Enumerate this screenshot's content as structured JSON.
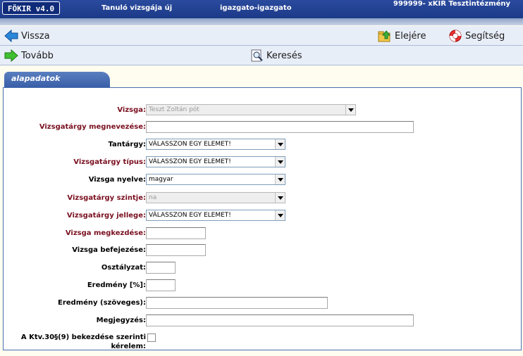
{
  "topbar": {
    "logo": "FÖKIR v4.0",
    "page": "Tanuló vizsgája új",
    "user": "igazgato-igazgato",
    "institution": "999999- xKIR Tesztintézmény"
  },
  "toolbar1": {
    "back": "Vissza",
    "top": "Elejére",
    "help": "Segítség"
  },
  "toolbar2": {
    "next": "Tovább",
    "search": "Keresés"
  },
  "tab": {
    "label": "alapadatok"
  },
  "form": {
    "vizsga": {
      "label": "Vizsga:",
      "value": "Teszt Zoltán pót"
    },
    "megnevezes": {
      "label": "Vizsgatárgy megnevezése:",
      "value": ""
    },
    "tantargy": {
      "label": "Tantárgy:",
      "value": "VÁLASSZON EGY ELEMET!"
    },
    "tipus": {
      "label": "Vizsgatárgy típus:",
      "value": "VÁLASSZON EGY ELEMET!"
    },
    "nyelv": {
      "label": "Vizsga nyelve:",
      "value": "magyar"
    },
    "szint": {
      "label": "Vizsgatárgy szintje:",
      "value": "na"
    },
    "jelleg": {
      "label": "Vizsgatárgy jellege:",
      "value": "VÁLASSZON EGY ELEMET!"
    },
    "kezdes": {
      "label": "Vizsga megkezdése:",
      "value": ""
    },
    "befejezes": {
      "label": "Vizsga befejezése:",
      "value": ""
    },
    "osztalyzat": {
      "label": "Osztályzat:",
      "value": ""
    },
    "eredmeny_szazalek": {
      "label": "Eredmény [%]:",
      "value": ""
    },
    "eredmeny_szoveges": {
      "label": "Eredmény (szöveges):",
      "value": ""
    },
    "megjegyzes": {
      "label": "Megjegyzés:",
      "value": ""
    },
    "ktv": {
      "label_line1": "A Ktv.30§(9) bekezdése szerinti",
      "label_line2": "kérelem:",
      "checked": false
    }
  },
  "colors": {
    "topbar": "#1c3a88",
    "required_label": "#7a1020",
    "tab": "#3a5fa8"
  }
}
